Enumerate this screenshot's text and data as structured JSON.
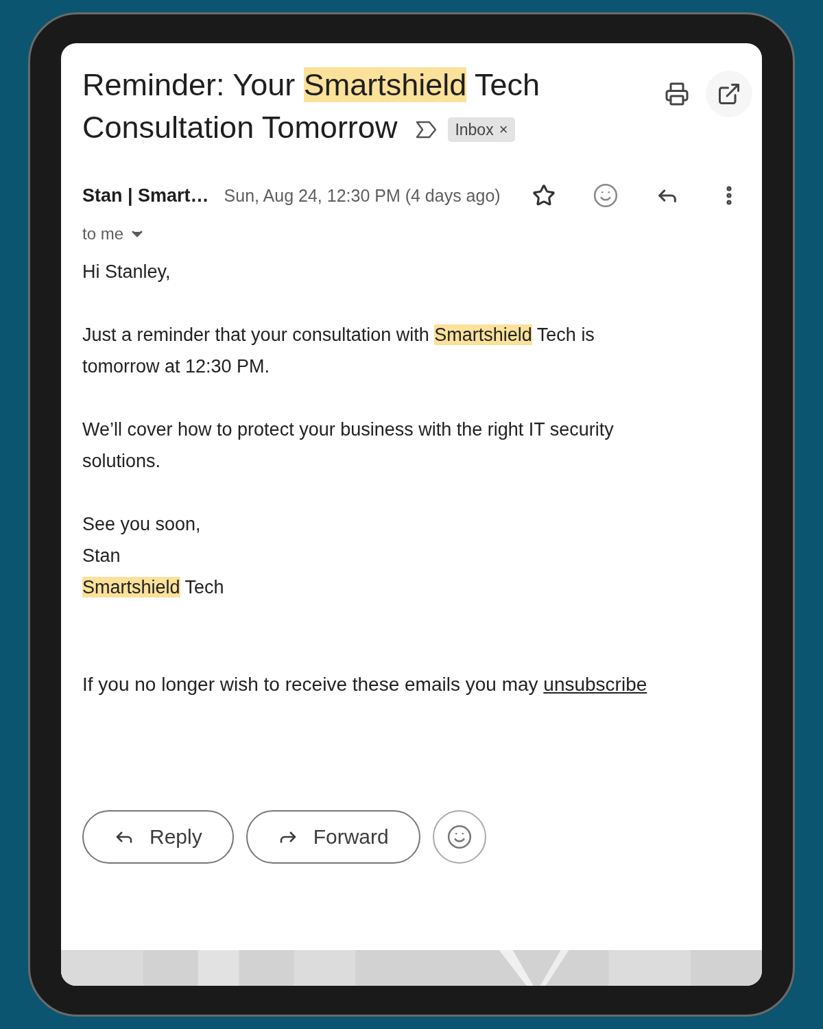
{
  "email": {
    "subject": [
      {
        "text": "Reminder: Your ",
        "highlighted": false
      },
      {
        "text": "Smartshield",
        "highlighted": true
      },
      {
        "text": " Tech Consultation Tomorrow",
        "highlighted": false
      }
    ],
    "label_chip": {
      "label": "Inbox",
      "remove": "×"
    },
    "sender": "Stan | Smart…",
    "date": "Sun, Aug 24, 12:30 PM (4 days ago)",
    "recipient": "to me",
    "starred": false,
    "body": [
      {
        "kind": "paragraph",
        "segments": [
          {
            "text": "Hi Stanley,",
            "highlighted": false
          }
        ]
      },
      {
        "kind": "paragraph",
        "segments": [
          {
            "text": "Just a reminder that your consultation with ",
            "highlighted": false
          },
          {
            "text": "Smartshield",
            "highlighted": true
          },
          {
            "text": " Tech is tomorrow at 12:30 PM.",
            "highlighted": false
          }
        ]
      },
      {
        "kind": "paragraph",
        "segments": [
          {
            "text": "We’ll cover how to protect your business with the right IT security solutions.",
            "highlighted": false
          }
        ]
      },
      {
        "kind": "signature",
        "lines": [
          [
            {
              "text": "See you soon,",
              "highlighted": false
            }
          ],
          [
            {
              "text": "Stan",
              "highlighted": false
            }
          ],
          [
            {
              "text": "Smartshield",
              "highlighted": true
            },
            {
              "text": " Tech",
              "highlighted": false
            }
          ]
        ]
      },
      {
        "kind": "footer",
        "text": "If you no longer wish to receive these emails you may ",
        "link": "unsubscribe"
      }
    ],
    "actions": [
      {
        "kind": "reply",
        "label": "Reply"
      },
      {
        "kind": "forward",
        "label": "Forward"
      },
      {
        "kind": "emoji"
      }
    ]
  }
}
